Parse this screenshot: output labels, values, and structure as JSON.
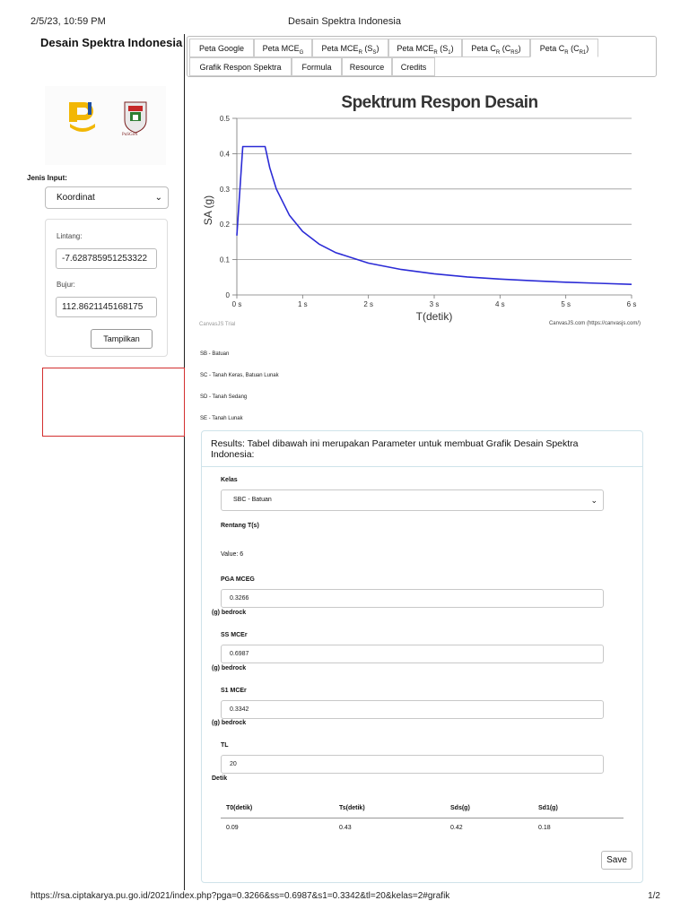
{
  "print": {
    "datetime": "2/5/23, 10:59 PM",
    "doc_title": "Desain Spektra Indonesia",
    "url": "https://rsa.ciptakarya.pu.go.id/2021/index.php?pga=0.3266&ss=0.6987&s1=0.3342&tl=20&kelas=2#grafik",
    "page": "1/2"
  },
  "app": {
    "title": "Desain Spektra Indonesia",
    "logo_text": "PuSGeN"
  },
  "sidebar": {
    "input_label": "Jenis Input:",
    "input_type": "Koordinat",
    "lintang_label": "Lintang:",
    "lintang_value": "-7.628785951253322",
    "bujur_label": "Bujur:",
    "bujur_value": "112.8621145168175",
    "submit_label": "Tampilkan"
  },
  "tabs": [
    {
      "label": "Peta Google"
    },
    {
      "label": "Peta MCE",
      "sub": "G"
    },
    {
      "label": "Peta MCE",
      "sub": "R",
      "tail": " (S",
      "tail_sub": "S",
      "tail_end": ")"
    },
    {
      "label": "Peta MCE",
      "sub": "R",
      "tail": " (S",
      "tail_sub": "1",
      "tail_end": ")"
    },
    {
      "label": "Peta C",
      "sub": "R",
      "tail": " (C",
      "tail_sub": "RS",
      "tail_end": ")"
    },
    {
      "label": "Peta C",
      "sub": "R",
      "tail": " (C",
      "tail_sub": "R1",
      "tail_end": ")"
    },
    {
      "label": "Grafik Respon Spektra"
    },
    {
      "label": "Formula"
    },
    {
      "label": "Resource"
    },
    {
      "label": "Credits"
    }
  ],
  "chart_data": {
    "type": "line",
    "title": "Spektrum Respon Desain",
    "xlabel": "T(detik)",
    "ylabel": "SA (g)",
    "xlim": [
      0,
      6
    ],
    "ylim": [
      0,
      0.5
    ],
    "x_ticks": [
      "0 s",
      "1 s",
      "2 s",
      "3 s",
      "4 s",
      "5 s",
      "6 s"
    ],
    "y_ticks": [
      "0",
      "0.1",
      "0.2",
      "0.3",
      "0.4",
      "0.5"
    ],
    "grid": "horizontal",
    "series": [
      {
        "color": "#2b2bd6",
        "x": [
          0,
          0.09,
          0.43,
          0.5,
          0.6,
          0.8,
          1.0,
          1.25,
          1.5,
          2.0,
          2.5,
          3.0,
          3.5,
          4.0,
          4.5,
          5.0,
          5.5,
          6.0
        ],
        "y": [
          0.168,
          0.42,
          0.42,
          0.36,
          0.3,
          0.225,
          0.18,
          0.144,
          0.12,
          0.09,
          0.072,
          0.06,
          0.051,
          0.045,
          0.04,
          0.036,
          0.033,
          0.03
        ]
      }
    ],
    "credit_left": "CanvasJS Trial",
    "credit_right": "CanvasJS.com (https://canvasjs.com/)"
  },
  "site_classes": [
    "SB - Batuan",
    "SC - Tanah Keras, Batuan Lunak",
    "SD - Tanah Sedang",
    "SE - Tanah Lunak"
  ],
  "results": {
    "heading": "Results: Tabel dibawah ini merupakan Parameter untuk membuat Grafik Desain Spektra Indonesia:",
    "kelas_label": "Kelas",
    "kelas_value": "SBC - Batuan",
    "rentang_label": "Rentang T(s)",
    "rentang_value": "Value: 6",
    "pga_label": "PGA MCEG",
    "pga_value": "0.3266",
    "pga_unit": "(g) bedrock",
    "ss_label": "SS MCEr",
    "ss_value": "0.6987",
    "ss_unit": "(g) bedrock",
    "s1_label": "S1 MCEr",
    "s1_value": "0.3342",
    "s1_unit": "(g) bedrock",
    "tl_label": "TL",
    "tl_value": "20",
    "tl_unit": "Detik",
    "table_headers": [
      "T0(detik)",
      "Ts(detik)",
      "Sds(g)",
      "Sd1(g)"
    ],
    "table_values": [
      "0.09",
      "0.43",
      "0.42",
      "0.18"
    ],
    "save_label": "Save"
  }
}
